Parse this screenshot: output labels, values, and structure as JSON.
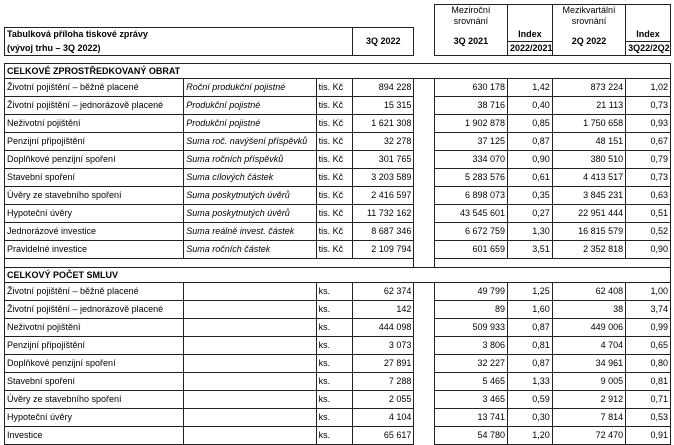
{
  "header": {
    "title_line1": "Tabulková příloha tiskové zprávy",
    "title_line2": "(vývoj trhu – 3Q 2022)",
    "col_3q2022": "3Q 2022",
    "col_3q2021": "3Q 2021",
    "group_yoy_line1": "Meziroční",
    "group_yoy_line2": "srovnání",
    "index_label": "Index",
    "index_yoy": "2022/2021",
    "col_2q2022": "2Q 2022",
    "group_qoq_line1": "Mezikvartální",
    "group_qoq_line2": "srovnání",
    "index_qoq": "3Q22/2Q22"
  },
  "section1": {
    "title": "CELKOVÉ ZPROSTŘEDKOVANÝ OBRAT",
    "rows": [
      {
        "name": "Životní pojištění – běžně placené",
        "metric": "Roční produkční pojistné",
        "unit": "tis. Kč",
        "v3q22": "894 228",
        "v3q21": "630 178",
        "idx1": "1,42",
        "v2q22": "873 224",
        "idx2": "1,02"
      },
      {
        "name": "Životní pojištění – jednorázově placené",
        "metric": "Produkční pojistné",
        "unit": "tis. Kč",
        "v3q22": "15 315",
        "v3q21": "38 716",
        "idx1": "0,40",
        "v2q22": "21 113",
        "idx2": "0,73"
      },
      {
        "name": "Neživotní pojištění",
        "metric": "Produkční pojistné",
        "unit": "tis. Kč",
        "v3q22": "1 621 308",
        "v3q21": "1 902 878",
        "idx1": "0,85",
        "v2q22": "1 750 658",
        "idx2": "0,93"
      },
      {
        "name": "Penzijní připojištění",
        "metric": "Suma roč. navýšení příspěvků",
        "unit": "tis. Kč",
        "v3q22": "32 278",
        "v3q21": "37 125",
        "idx1": "0,87",
        "v2q22": "48 151",
        "idx2": "0,67"
      },
      {
        "name": "Doplňkové penzijní spoření",
        "metric": "Suma ročních příspěvků",
        "unit": "tis. Kč",
        "v3q22": "301 765",
        "v3q21": "334 070",
        "idx1": "0,90",
        "v2q22": "380 510",
        "idx2": "0,79"
      },
      {
        "name": "Stavební spoření",
        "metric": "Suma cílových částek",
        "unit": "tis. Kč",
        "v3q22": "3 203 589",
        "v3q21": "5 283 576",
        "idx1": "0,61",
        "v2q22": "4 413 517",
        "idx2": "0,73"
      },
      {
        "name": "Úvěry ze stavebního spoření",
        "metric": "Suma poskytnutých úvěrů",
        "unit": "tis. Kč",
        "v3q22": "2 416 597",
        "v3q21": "6 898 073",
        "idx1": "0,35",
        "v2q22": "3 845 231",
        "idx2": "0,63"
      },
      {
        "name": "Hypoteční úvěry",
        "metric": "Suma poskytnutých úvěrů",
        "unit": "tis. Kč",
        "v3q22": "11 732 162",
        "v3q21": "43 545 601",
        "idx1": "0,27",
        "v2q22": "22 951 444",
        "idx2": "0,51"
      },
      {
        "name": "Jednorázové investice",
        "metric": "Suma reálně invest. částek",
        "unit": "tis. Kč",
        "v3q22": "8 687 346",
        "v3q21": "6 672 759",
        "idx1": "1,30",
        "v2q22": "16 815 579",
        "idx2": "0,52"
      },
      {
        "name": "Pravidelné investice",
        "metric": "Suma ročních částek",
        "unit": "tis. Kč",
        "v3q22": "2 109 794",
        "v3q21": "601 659",
        "idx1": "3,51",
        "v2q22": "2 352 818",
        "idx2": "0,90"
      }
    ]
  },
  "section2": {
    "title": "CELKOVÝ POČET SMLUV",
    "rows": [
      {
        "name": "Životní pojištění – běžně placené",
        "metric": "",
        "unit": "ks.",
        "v3q22": "62 374",
        "v3q21": "49 799",
        "idx1": "1,25",
        "v2q22": "62 408",
        "idx2": "1,00"
      },
      {
        "name": "Životní pojištění – jednorázově placené",
        "metric": "",
        "unit": "ks.",
        "v3q22": "142",
        "v3q21": "89",
        "idx1": "1,60",
        "v2q22": "38",
        "idx2": "3,74"
      },
      {
        "name": "Neživotní pojištění",
        "metric": "",
        "unit": "ks.",
        "v3q22": "444 098",
        "v3q21": "509 933",
        "idx1": "0,87",
        "v2q22": "449 006",
        "idx2": "0,99"
      },
      {
        "name": "Penzijní připojištění",
        "metric": "",
        "unit": "ks.",
        "v3q22": "3 073",
        "v3q21": "3 806",
        "idx1": "0,81",
        "v2q22": "4 704",
        "idx2": "0,65"
      },
      {
        "name": "Doplňkové penzijní spoření",
        "metric": "",
        "unit": "ks.",
        "v3q22": "27 891",
        "v3q21": "32 227",
        "idx1": "0,87",
        "v2q22": "34 961",
        "idx2": "0,80"
      },
      {
        "name": "Stavební spoření",
        "metric": "",
        "unit": "ks.",
        "v3q22": "7 288",
        "v3q21": "5 465",
        "idx1": "1,33",
        "v2q22": "9 005",
        "idx2": "0,81"
      },
      {
        "name": "Úvěry ze stavebního spoření",
        "metric": "",
        "unit": "ks.",
        "v3q22": "2 055",
        "v3q21": "3 465",
        "idx1": "0,59",
        "v2q22": "2 912",
        "idx2": "0,71"
      },
      {
        "name": "Hypoteční úvěry",
        "metric": "",
        "unit": "ks.",
        "v3q22": "4 104",
        "v3q21": "13 741",
        "idx1": "0,30",
        "v2q22": "7 814",
        "idx2": "0,53"
      },
      {
        "name": "Investice",
        "metric": "",
        "unit": "ks.",
        "v3q22": "65 617",
        "v3q21": "54 780",
        "idx1": "1,20",
        "v2q22": "72 470",
        "idx2": "0,91"
      }
    ]
  }
}
